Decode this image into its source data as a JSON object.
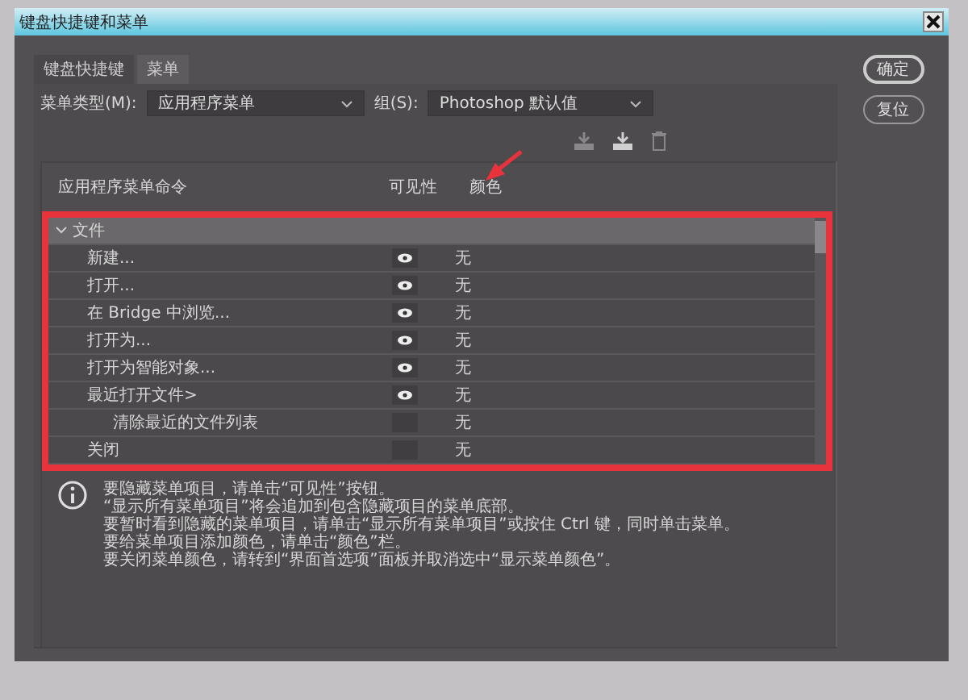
{
  "window": {
    "title": "键盘快捷键和菜单"
  },
  "tabs": [
    {
      "label": "键盘快捷键",
      "selected": false
    },
    {
      "label": "菜单",
      "selected": true
    }
  ],
  "menu_type": {
    "label": "菜单类型(M):",
    "value": "应用程序菜单"
  },
  "group": {
    "label": "组(S):",
    "value": "Photoshop 默认值"
  },
  "table": {
    "columns": [
      "应用程序菜单命令",
      "可见性",
      "颜色"
    ],
    "rows": [
      {
        "label": "文件",
        "kind": "group",
        "expanded": true,
        "children": [
          {
            "label": "新建...",
            "kind": "item",
            "visible": true,
            "color_label": "无"
          },
          {
            "label": "打开...",
            "kind": "item",
            "visible": true,
            "color_label": "无"
          },
          {
            "label": "在 Bridge 中浏览...",
            "kind": "item",
            "visible": true,
            "color_label": "无"
          },
          {
            "label": "打开为...",
            "kind": "item",
            "visible": true,
            "color_label": "无"
          },
          {
            "label": "打开为智能对象...",
            "kind": "item",
            "visible": true,
            "color_label": "无"
          },
          {
            "label": "最近打开文件>",
            "kind": "item",
            "visible": true,
            "color_label": "无",
            "children": [
              {
                "label": "清除最近的文件列表",
                "kind": "item",
                "visible": false,
                "color_label": "无"
              }
            ]
          },
          {
            "label": "关闭",
            "kind": "item",
            "visible": false,
            "color_label": "无"
          }
        ]
      }
    ]
  },
  "info_lines": [
    "要隐藏菜单项目，请单击“可见性”按钮。",
    "“显示所有菜单项目”将会追加到包含隐藏项目的菜单底部。",
    "要暂时看到隐藏的菜单项目，请单击“显示所有菜单项目”或按住 Ctrl 键，同时单击菜单。",
    "要给菜单项目添加颜色，请单击“颜色”栏。",
    "要关闭菜单颜色，请转到“界面首选项”面板并取消选中“显示菜单颜色”。"
  ],
  "buttons": [
    "确定",
    "复位"
  ]
}
